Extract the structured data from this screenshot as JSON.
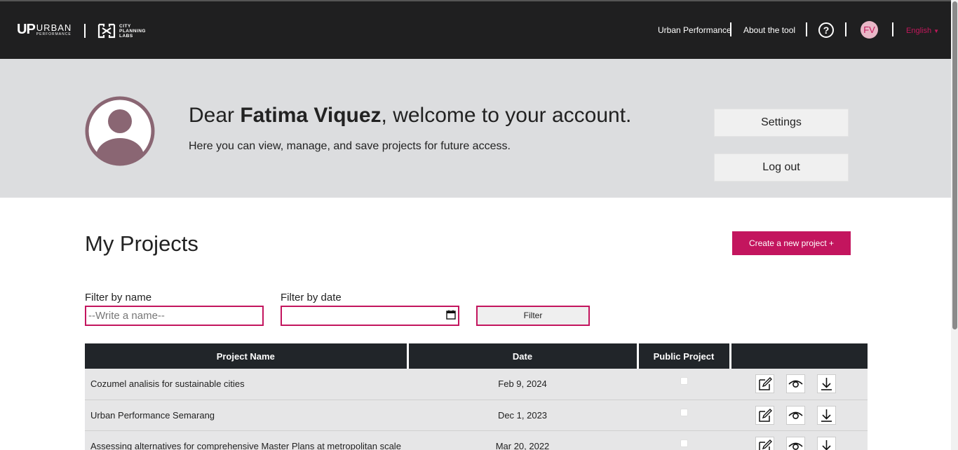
{
  "brand": {
    "up_mark": "UP",
    "up_word": "URBAN",
    "up_sub": "PERFORMANCE",
    "cpl_line1": "CITY",
    "cpl_line2": "PLANNING",
    "cpl_line3": "LABS"
  },
  "nav": {
    "links": [
      "Urban Performance",
      "About the tool"
    ],
    "help_label": "?",
    "user_initials": "FV",
    "language": "English"
  },
  "hero": {
    "greeting_prefix": "Dear ",
    "user_name": "Fatima Viquez",
    "greeting_suffix": ", welcome to your account.",
    "subtitle": "Here you can view, manage, and save projects for future access.",
    "settings_label": "Settings",
    "logout_label": "Log out"
  },
  "projects": {
    "title": "My Projects",
    "create_label": "Create a new project +",
    "filter_name_label": "Filter by name",
    "filter_name_placeholder": "--Write a name--",
    "filter_date_label": "Filter by date",
    "filter_button": "Filter",
    "columns": [
      "Project Name",
      "Date",
      "Public Project",
      ""
    ],
    "rows": [
      {
        "name": "Cozumel analisis for sustainable cities",
        "date": "Feb 9, 2024",
        "public": false
      },
      {
        "name": "Urban Performance Semarang",
        "date": "Dec 1, 2023",
        "public": false
      },
      {
        "name": "Assessing alternatives for comprehensive Master Plans at metropolitan scale",
        "date": "Mar 20, 2022",
        "public": false
      }
    ],
    "row_actions": [
      "edit-icon",
      "view-icon",
      "download-icon"
    ]
  },
  "colors": {
    "accent": "#c3155e",
    "topbar": "#1f1f20",
    "hero_bg": "#dcdddf",
    "table_header": "#212529",
    "avatar_grey": "#8a6673"
  }
}
